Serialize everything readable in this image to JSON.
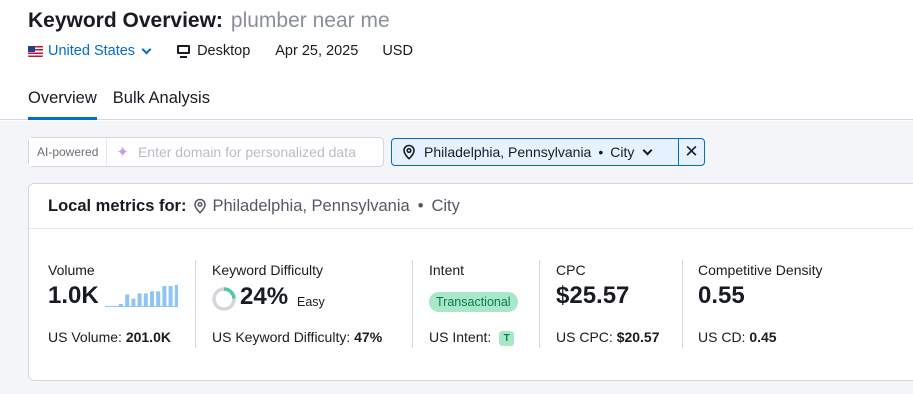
{
  "header": {
    "title": "Keyword Overview:",
    "keyword": "plumber near me",
    "database": "United States",
    "device": "Desktop",
    "date": "Apr 25, 2025",
    "currency": "USD"
  },
  "tabs": [
    {
      "label": "Overview",
      "active": true
    },
    {
      "label": "Bulk Analysis",
      "active": false
    }
  ],
  "personalize": {
    "label": "AI-powered",
    "placeholder": "Enter domain for personalized data",
    "value": ""
  },
  "location_filter": {
    "city": "Philadelphia, Pennsylvania",
    "separator": "•",
    "type": "City"
  },
  "local_metrics": {
    "heading": "Local metrics for:",
    "location": "Philadelphia, Pennsylvania",
    "separator": "•",
    "type": "City"
  },
  "metrics": {
    "volume": {
      "label": "Volume",
      "value": "1.0K",
      "us_label": "US Volume:",
      "us_value": "201.0K",
      "trend": [
        0.1,
        0.55,
        0.35,
        0.6,
        0.6,
        0.7,
        0.7,
        0.95,
        0.95,
        1.0
      ]
    },
    "kd": {
      "label": "Keyword Difficulty",
      "value": "24%",
      "level": "Easy",
      "percent": 24,
      "us_label": "US Keyword Difficulty:",
      "us_value": "47%"
    },
    "intent": {
      "label": "Intent",
      "value": "Transactional",
      "us_label": "US Intent:",
      "us_value": "T"
    },
    "cpc": {
      "label": "CPC",
      "value": "$25.57",
      "us_label": "US CPC:",
      "us_value": "$20.57"
    },
    "cd": {
      "label": "Competitive Density",
      "value": "0.55",
      "us_label": "US CD:",
      "us_value": "0.45"
    }
  },
  "colors": {
    "link": "#006dca",
    "kd_ring": "#4fca9b",
    "intent_bg": "#a8e8c9",
    "trend_bars": "#8fc4f4"
  }
}
